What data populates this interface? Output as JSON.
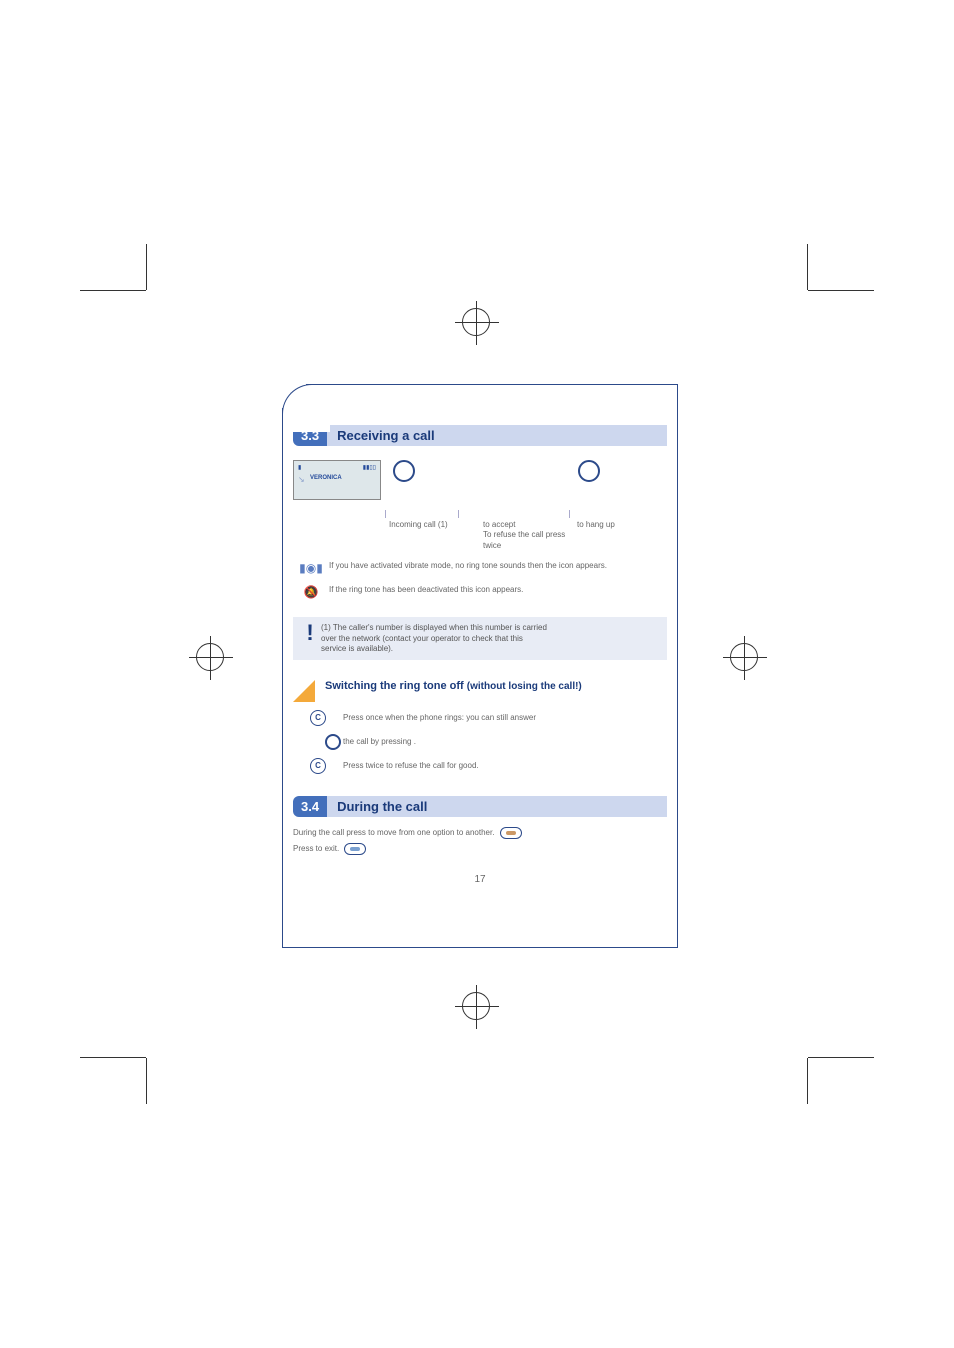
{
  "colors": {
    "accent": "#1a3a7a",
    "header_bg": "#cdd7ee",
    "num_bg": "#436fbb",
    "triangle": "#f4a93a"
  },
  "sections": {
    "s1": {
      "num": "3.3",
      "title": "Receiving a call"
    },
    "s2": {
      "num": "3.4",
      "title": "During the call"
    }
  },
  "screen": {
    "battery_icon": "▮",
    "signal_icon": "▮▮▯▯",
    "incoming_arrow": "↘",
    "caller_name": "VERONICA"
  },
  "info_cols": {
    "c1": "Incoming call (1)",
    "c2_a": "to accept",
    "c2_b": "To refuse the call press twice",
    "c3": "to hang up"
  },
  "icon_rows": {
    "vibrate_icon": "▮◉▮",
    "vibrate_text": "If you have activated vibrate mode, no ring tone sounds then the icon appears.",
    "ring_icon": "🔕",
    "ring_text": "If the ring tone has been deactivated this icon appears."
  },
  "note": {
    "mark": "!",
    "line1": "(1) The caller's number is displayed when this number is carried",
    "line2": "over the network (contact your operator to check that this",
    "line3": "service is available)."
  },
  "subhead": {
    "main": "Switching the ring tone off ",
    "paren": "(without losing the call!)"
  },
  "steps": {
    "s1": "Press         once when the phone rings: you can still answer",
    "s2": "the call by pressing        .",
    "s3": "Press         twice to refuse the call for good."
  },
  "step_icons": {
    "c_label": "C"
  },
  "during": {
    "line1": "During the call press        to move from one option to another.",
    "line2": "Press        to exit."
  },
  "page_number": "17"
}
